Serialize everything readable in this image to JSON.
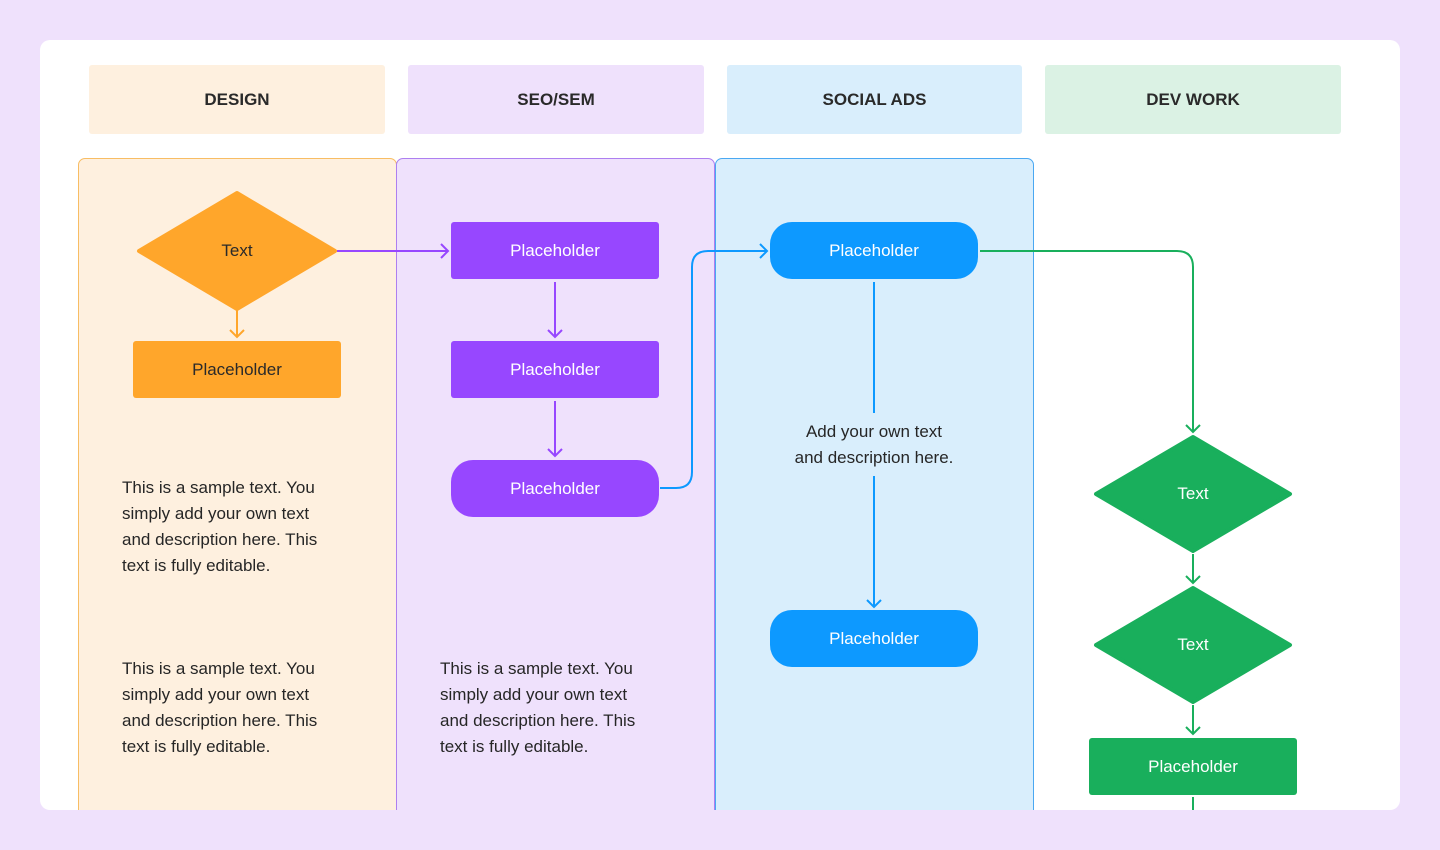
{
  "colors": {
    "page_bg": "#efe1fc",
    "design": "#ffa62b",
    "seo": "#9747ff",
    "social": "#0d99ff",
    "dev": "#19af5c"
  },
  "lanes": [
    {
      "id": "design",
      "header": "DESIGN"
    },
    {
      "id": "seo",
      "header": "SEO/SEM"
    },
    {
      "id": "social",
      "header": "SOCIAL ADS"
    },
    {
      "id": "dev",
      "header": "DEV WORK"
    }
  ],
  "design": {
    "diamond": "Text",
    "box": "Placeholder",
    "desc1": [
      "This is a sample text. You",
      "simply add your own text",
      "and description here. This",
      "text is fully editable."
    ],
    "desc2": [
      "This is a sample text. You",
      "simply add your own text",
      "and description here. This",
      "text is fully editable."
    ]
  },
  "seo": {
    "box1": "Placeholder",
    "box2": "Placeholder",
    "box3": "Placeholder",
    "desc": [
      "This is a sample text. You",
      "simply add your own text",
      "and description here. This",
      "text is fully editable."
    ]
  },
  "social": {
    "box1": "Placeholder",
    "label": [
      "Add your own text",
      "and description here."
    ],
    "box2": "Placeholder"
  },
  "dev": {
    "diamond1": "Text",
    "diamond2": "Text",
    "box": "Placeholder"
  }
}
